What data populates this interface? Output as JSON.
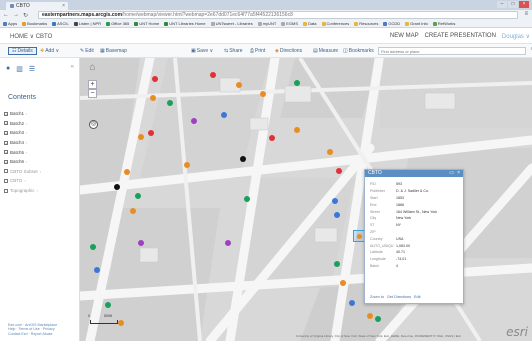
{
  "browser": {
    "tab_title": "CBTO",
    "url_domain": "easternpartners.maps.arcgis.com",
    "url_path": "/home/webmap/viewer.html?webmap=2e67dd071ec64f77a5f44522136156c8",
    "bookmarks": [
      {
        "label": "Apps",
        "color": "#4d7bc4"
      },
      {
        "label": "Bookmarks",
        "color": "#e0a030"
      },
      {
        "label": "ASCIL",
        "color": "#3a78c2"
      },
      {
        "label": "Listen | NPR",
        "color": "#444444"
      },
      {
        "label": "Office 365",
        "color": "#2e9b4b"
      },
      {
        "label": "UNT Home",
        "color": "#2e8b3e"
      },
      {
        "label": "UNT Libraries Home",
        "color": "#2e8b3e"
      },
      {
        "label": "UNTsweet - Libraries",
        "color": "#aaaaaa"
      },
      {
        "label": "myUNT",
        "color": "#aaaaaa"
      },
      {
        "label": "EGMS",
        "color": "#aaaaaa"
      },
      {
        "label": "Data",
        "color": "#e3b93a"
      },
      {
        "label": "Conferences",
        "color": "#e3b93a"
      },
      {
        "label": "Resources",
        "color": "#e3b93a"
      },
      {
        "label": "GCDD",
        "color": "#4d7bc4"
      },
      {
        "label": "Grant Info",
        "color": "#e3b93a"
      },
      {
        "label": "RefWorks",
        "color": "#5fa04e"
      }
    ]
  },
  "app_header": {
    "home_label": "HOME ∨ CBTO",
    "new_map": "NEW MAP",
    "create_presentation": "CREATE PRESENTATION",
    "user": "Douglas ∨"
  },
  "toolbar": {
    "details": "Details",
    "add": "Add ∨",
    "edit": "Edit",
    "basemap": "Basemap",
    "save": "Save ∨",
    "share": "Share",
    "print": "Print",
    "directions": "Directions",
    "measure": "Measure",
    "bookmarks": "Bookmarks",
    "search_placeholder": "Find address or place"
  },
  "sidepanel": {
    "contents_title": "Contents",
    "layers": [
      {
        "label": "Batch1",
        "checked": true
      },
      {
        "label": "Batch2",
        "checked": true
      },
      {
        "label": "Batch3",
        "checked": true
      },
      {
        "label": "Batch4",
        "checked": true
      },
      {
        "label": "Batch5",
        "checked": true
      },
      {
        "label": "Batch6",
        "checked": true
      },
      {
        "label": "CBTO Subset",
        "checked": false
      },
      {
        "label": "CBTO",
        "checked": false
      },
      {
        "label": "Topographic",
        "checked": false
      }
    ],
    "footer_line1": "Esri.com · ArcGIS Marketplace",
    "footer_line2": "Help · Terms of Use · Privacy",
    "footer_line3": "Contact Esri · Report Abuse"
  },
  "map": {
    "scale_left": "0",
    "scale_right": "500ft",
    "attribution": "University of Virginia Library, City of New York, State of New York, Esri, HERE, DeLorme, INCREMENT P, NGA, USGS | Esri",
    "esri_logo": "esri",
    "points": [
      {
        "color": "#e0303a"
      },
      {
        "color": "#1aa05a"
      },
      {
        "color": "#3a78d8"
      },
      {
        "color": "#a040c0"
      },
      {
        "color": "#e98c25"
      },
      {
        "color": "#111111"
      }
    ]
  },
  "popup": {
    "title": "CBTO",
    "rows": [
      {
        "key": "FID",
        "val": "593"
      },
      {
        "key": "Publisher",
        "val": "D. & J. Sadlier & Co."
      },
      {
        "key": "Start",
        "val": "1853"
      },
      {
        "key": "End",
        "val": "1866"
      },
      {
        "key": "Street",
        "val": "164 William St., New York"
      },
      {
        "key": "City",
        "val": "New York"
      },
      {
        "key": "ST",
        "val": "NY"
      },
      {
        "key": "ZIP",
        "val": ""
      },
      {
        "key": "Country",
        "val": "USA"
      },
      {
        "key": "AUTO_UNIQU",
        "val": "1,083.00"
      },
      {
        "key": "Latitude",
        "val": "40.71"
      },
      {
        "key": "Longitude",
        "val": "-74.01"
      },
      {
        "key": "Batch",
        "val": "4"
      }
    ],
    "zoom_to": "Zoom to",
    "get_directions": "Get Directions",
    "edit": "Edit"
  }
}
